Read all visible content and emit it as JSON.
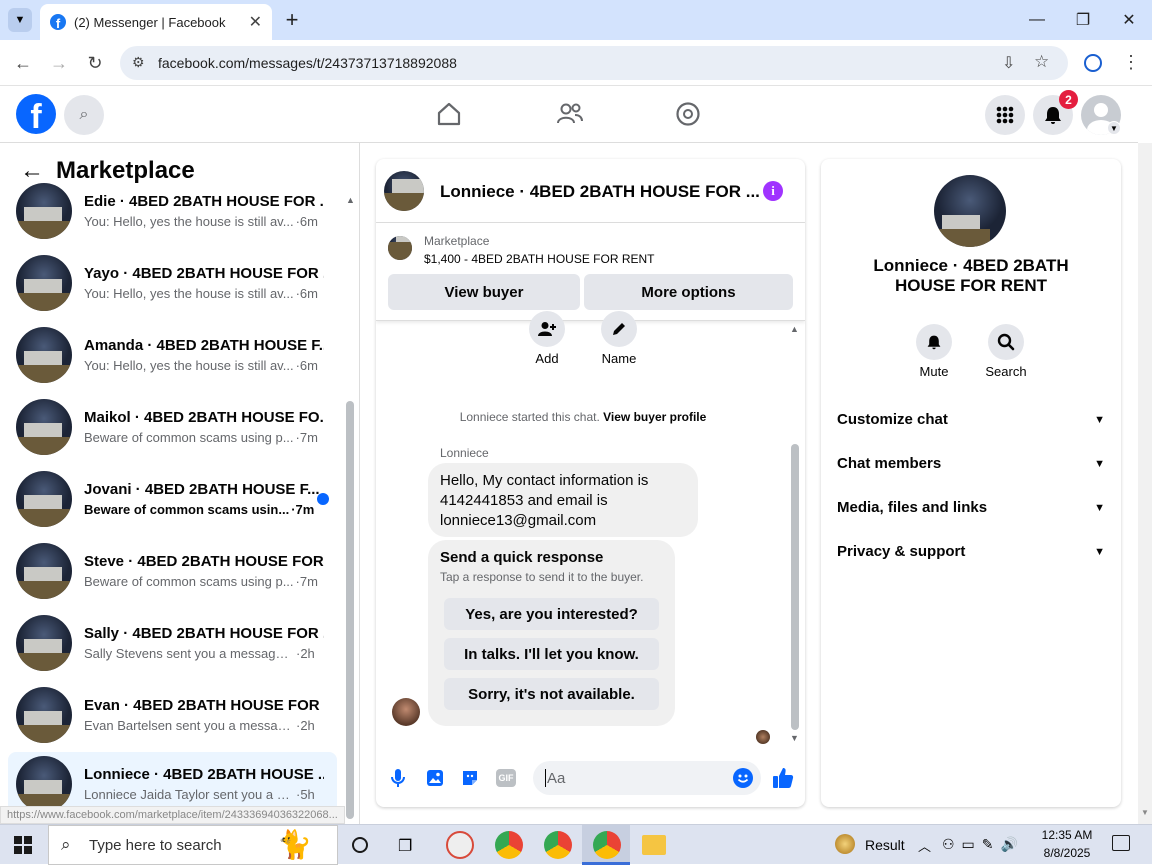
{
  "browser": {
    "tab_title": "(2) Messenger | Facebook",
    "url": "facebook.com/messages/t/24373713718892088",
    "status_url": "https://www.facebook.com/marketplace/item/24333694036322068..."
  },
  "fb_header": {
    "notification_count": "2"
  },
  "left_panel": {
    "title": "Marketplace",
    "conversations": [
      {
        "title": "Edie · 4BED 2BATH HOUSE FOR ...",
        "message": "You: Hello, yes the house is still av...",
        "time": "·6m",
        "unread": false
      },
      {
        "title": "Yayo · 4BED 2BATH HOUSE FOR ...",
        "message": "You: Hello, yes the house is still av...",
        "time": "·6m",
        "unread": false
      },
      {
        "title": "Amanda · 4BED 2BATH HOUSE F...",
        "message": "You: Hello, yes the house is still av...",
        "time": "·6m",
        "unread": false
      },
      {
        "title": "Maikol · 4BED 2BATH HOUSE FO...",
        "message": "Beware of common scams using p...",
        "time": "·7m",
        "unread": false
      },
      {
        "title": "Jovani · 4BED 2BATH HOUSE F...",
        "message": "Beware of common scams usin...",
        "time": "·7m",
        "unread": true
      },
      {
        "title": "Steve · 4BED 2BATH HOUSE FOR...",
        "message": "Beware of common scams using p...",
        "time": "·7m",
        "unread": false
      },
      {
        "title": "Sally · 4BED 2BATH HOUSE FOR ...",
        "message": "Sally Stevens sent you a message a...",
        "time": "·2h",
        "unread": false
      },
      {
        "title": "Evan · 4BED 2BATH HOUSE FOR ...",
        "message": "Evan Bartelsen sent you a message ...",
        "time": "·2h",
        "unread": false
      },
      {
        "title": "Lonniece · 4BED 2BATH HOUSE ...",
        "message": "Lonniece Jaida Taylor sent you a m...",
        "time": "·5h",
        "unread": false
      }
    ]
  },
  "chat": {
    "header_title": "Lonniece · 4BED 2BATH HOUSE FOR ...",
    "listing_label": "Marketplace",
    "listing_detail": "$1,400 - 4BED 2BATH HOUSE FOR RENT",
    "view_buyer": "View buyer",
    "more_options": "More options",
    "add_label": "Add",
    "name_label": "Name",
    "started_text": "Lonniece started this chat.",
    "view_profile": "View buyer profile",
    "sender": "Lonniece",
    "message": "Hello, My contact information is 4142441853 and email is lonniece13@gmail.com",
    "quick_title": "Send a quick response",
    "quick_sub": "Tap a response to send it to the buyer.",
    "quick_replies": [
      "Yes, are you interested?",
      "In talks. I'll let you know.",
      "Sorry, it's not available."
    ],
    "input_placeholder": "Aa"
  },
  "info": {
    "name": "Lonniece · 4BED 2BATH HOUSE FOR RENT",
    "mute": "Mute",
    "search": "Search",
    "sections": [
      "Customize chat",
      "Chat members",
      "Media, files and links",
      "Privacy & support"
    ]
  },
  "taskbar": {
    "search_placeholder": "Type here to search",
    "result_label": "Result",
    "time": "12:35 AM",
    "date": "8/8/2025"
  },
  "colors": {
    "fb_blue": "#0866ff",
    "notification_red": "#e41e3f",
    "info_purple": "#a033ff"
  }
}
